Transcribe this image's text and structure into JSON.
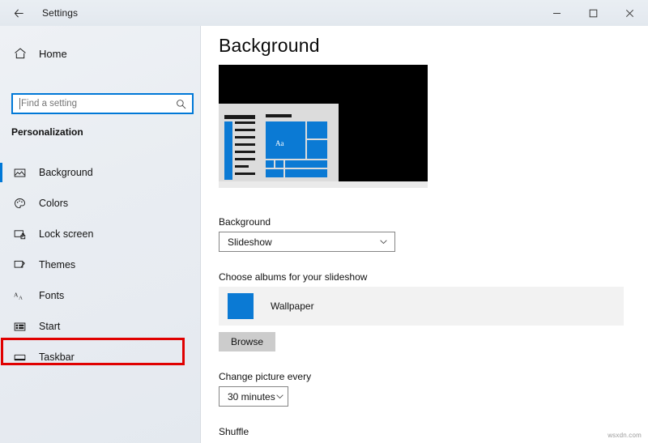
{
  "window": {
    "title": "Settings",
    "back_icon": "back-arrow-icon",
    "controls": {
      "minimize": "minimize-icon",
      "maximize": "maximize-icon",
      "close": "close-icon"
    }
  },
  "sidebar": {
    "home": {
      "label": "Home",
      "icon": "home-icon"
    },
    "search": {
      "placeholder": "Find a setting",
      "value": "",
      "icon": "search-icon"
    },
    "section_title": "Personalization",
    "items": [
      {
        "label": "Background",
        "icon": "image-icon",
        "selected": true,
        "highlighted": false
      },
      {
        "label": "Colors",
        "icon": "palette-icon",
        "selected": false,
        "highlighted": false
      },
      {
        "label": "Lock screen",
        "icon": "lock-screen-icon",
        "selected": false,
        "highlighted": false
      },
      {
        "label": "Themes",
        "icon": "themes-icon",
        "selected": false,
        "highlighted": false
      },
      {
        "label": "Fonts",
        "icon": "fonts-icon",
        "selected": false,
        "highlighted": false
      },
      {
        "label": "Start",
        "icon": "start-tiles-icon",
        "selected": false,
        "highlighted": false
      },
      {
        "label": "Taskbar",
        "icon": "taskbar-icon",
        "selected": false,
        "highlighted": true
      }
    ]
  },
  "main": {
    "page_title": "Background",
    "preview": {
      "alt": "desktop-preview",
      "tile_text": "Aa"
    },
    "background": {
      "label": "Background",
      "value": "Slideshow"
    },
    "albums": {
      "label": "Choose albums for your slideshow",
      "item_name": "Wallpaper",
      "browse_label": "Browse"
    },
    "interval": {
      "label": "Change picture every",
      "value": "30 minutes"
    },
    "shuffle": {
      "label": "Shuffle"
    }
  },
  "watermark": "wsxdn.com",
  "colors": {
    "accent": "#0078d7",
    "highlight": "#e00000",
    "tile_blue": "#0b7ad4",
    "panel_gray": "#f2f2f2",
    "button_gray": "#cccccc"
  }
}
